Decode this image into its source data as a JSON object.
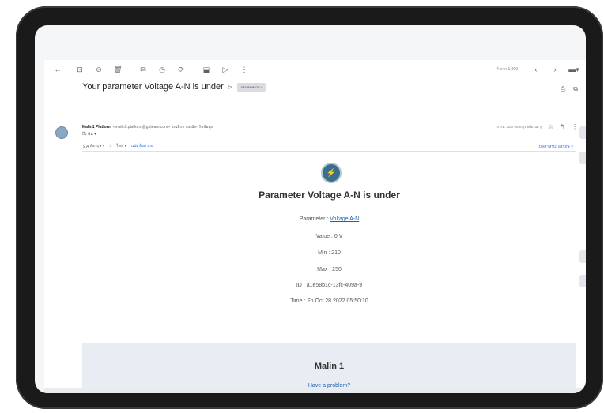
{
  "toolbar": {
    "back_icon": "←",
    "archive_icon": "⊡",
    "report_icon": "⊙",
    "delete_icon": "🗑",
    "mail_icon": "✉",
    "snooze_icon": "◷",
    "task_icon": "⟳",
    "move_icon": "⬓",
    "label_icon": "▷",
    "more_icon": "⋮",
    "pager": "4 จาก 1,000",
    "prev_icon": "‹",
    "next_icon": "›",
    "keyboard_icon": "▬▾"
  },
  "email": {
    "subject": "Your parameter Voltage A-N is under",
    "label_chip": "กล่องจดหมาย ×",
    "print_icon": "⎙",
    "popout_icon": "⧉",
    "sender_name": "Malin1 Platform",
    "sender_addr": "<malin1.platform@gpteam.com>",
    "sender_via": "ยกเลิกการสมัครรับข้อมูล",
    "to": "ถึง ฉัน ▾",
    "time": "4 ต.ค. 2022 05:50 (1 ปีที่ผ่านมา)",
    "star_icon": "☆",
    "reply_icon": "↰",
    "more_icon": "⋮",
    "translate": {
      "from": "อังกฤษ ▾",
      "arrow": ">",
      "to": "ไทย ▾",
      "link": "แปลข้อความ",
      "options": "ปิดสำหรับ: อังกฤษ ×"
    }
  },
  "body": {
    "heading": "Parameter Voltage A-N is under",
    "parameter_label": "Parameter : ",
    "parameter_value": "Voltage A-N",
    "value": "Value : 0 V",
    "min": "Min : 210",
    "max": "Max : 250",
    "id": "ID : a1e58b1c-13fc-409a-9",
    "time": "Time : Fri Oct 28 2022 05:50:10",
    "logo_icon": "⚡"
  },
  "footer": {
    "brand": "Malin 1",
    "help_link": "Have a problem?"
  }
}
